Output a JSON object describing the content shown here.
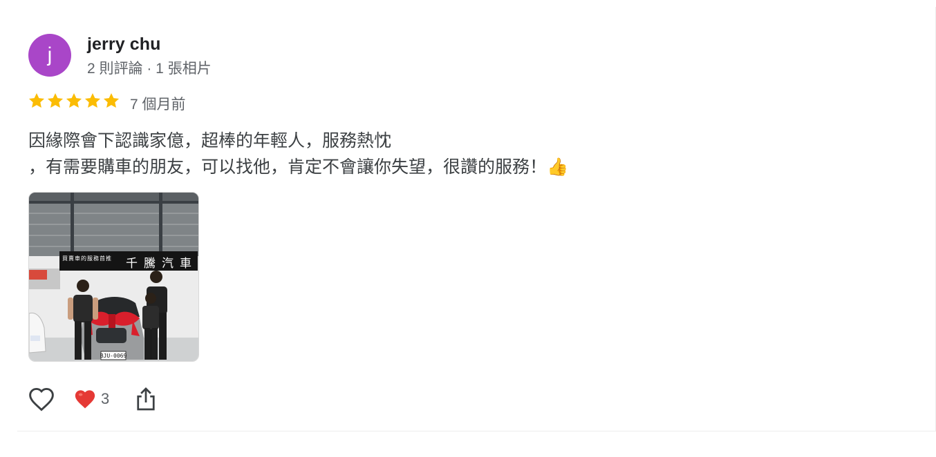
{
  "review": {
    "avatar_letter": "j",
    "avatar_color": "#a946c8",
    "author": "jerry chu",
    "author_meta": "2 則評論 · 1 張相片",
    "rating": 5,
    "time": "7 個月前",
    "text_line1": "因緣際會下認識家億，超棒的年輕人，服務熱忱",
    "text_line2": "，有需要購車的朋友，可以找他，肯定不會讓你失望，很讚的服務！👍",
    "photo": {
      "sign_small": "買賣車的服務首推",
      "sign_large": "千騰汽車",
      "plate": "BJU-0069"
    },
    "reactions": {
      "like_icon": "heart-outline-icon",
      "reaction_icon": "red-heart-icon",
      "count": "3",
      "share_icon": "share-icon"
    }
  },
  "colors": {
    "star": "#fbbc04",
    "heart": "#e53935",
    "text": "#3c4043",
    "muted": "#5f6368"
  }
}
